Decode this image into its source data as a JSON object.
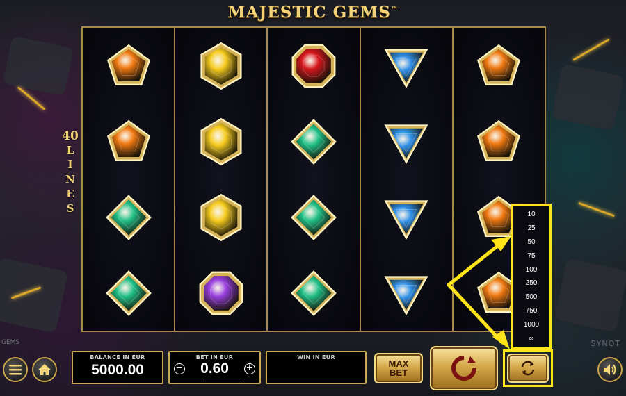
{
  "title": {
    "text": "MAJESTIC GEMS",
    "tm": "™"
  },
  "lines": {
    "count": "40",
    "word": [
      "L",
      "I",
      "N",
      "E",
      "S"
    ]
  },
  "brand": {
    "left": "GEMS",
    "right": "SYNOT"
  },
  "reels": [
    [
      "orange-pentagon-gem",
      "orange-pentagon-gem",
      "green-diamond-gem",
      "green-diamond-gem"
    ],
    [
      "yellow-hexagon-gem",
      "yellow-hexagon-gem",
      "yellow-hexagon-gem",
      "purple-octagon-gem"
    ],
    [
      "red-octagon-gem",
      "green-diamond-gem",
      "green-diamond-gem",
      "green-diamond-gem"
    ],
    [
      "blue-triangle-gem",
      "blue-triangle-gem",
      "blue-triangle-gem",
      "blue-triangle-gem"
    ],
    [
      "orange-pentagon-gem",
      "orange-pentagon-gem",
      "orange-pentagon-gem",
      "orange-pentagon-gem"
    ]
  ],
  "colors": {
    "highlight": "#ffe419",
    "gold": "#c7a857",
    "orange": "#f27a12",
    "yellow": "#f7cc1d",
    "red": "#d6171d",
    "green": "#1fbf86",
    "blue": "#2f8fe8",
    "purple": "#9a3fe0"
  },
  "balance": {
    "label": "BALANCE IN EUR",
    "value": "5000.00"
  },
  "bet": {
    "label": "BET IN EUR",
    "value": "0.60",
    "minus": "−",
    "plus": "+"
  },
  "win": {
    "label": "WIN IN EUR",
    "value": ""
  },
  "buttons": {
    "menu_icon": "hamburger-icon",
    "home_icon": "home-icon",
    "max_bet_line1": "MAX",
    "max_bet_line2": "BET",
    "spin_icon": "spin-arrow-icon",
    "autoplay_icon": "autoplay-icon",
    "sound_icon": "speaker-icon"
  },
  "autoplay_options": [
    "10",
    "25",
    "50",
    "75",
    "100",
    "250",
    "500",
    "750",
    "1000",
    "∞"
  ]
}
